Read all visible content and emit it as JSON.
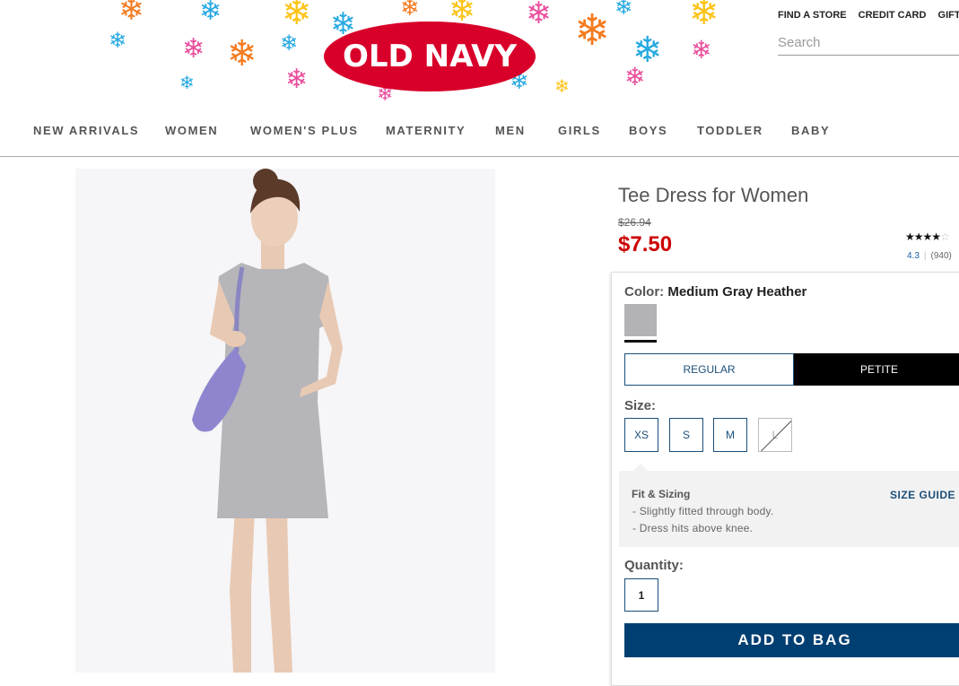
{
  "header": {
    "logo_text": "OLD NAVY",
    "utility_links": [
      "FIND A STORE",
      "CREDIT CARD",
      "GIFT CA"
    ],
    "search_placeholder": "Search"
  },
  "nav": [
    "NEW ARRIVALS",
    "WOMEN",
    "WOMEN'S PLUS",
    "MATERNITY",
    "MEN",
    "GIRLS",
    "BOYS",
    "TODDLER",
    "BABY"
  ],
  "product": {
    "title": "Tee Dress for Women",
    "old_price": "$26.94",
    "sale_price": "$7.50",
    "rating_stars": 4.3,
    "rating_value": "4.3",
    "review_count": "(940)",
    "color_label": "Color:",
    "color_value": "Medium Gray Heather",
    "fit_options": [
      "REGULAR",
      "PETITE"
    ],
    "selected_fit": "PETITE",
    "size_label": "Size:",
    "sizes": [
      "XS",
      "S",
      "M",
      "L"
    ],
    "unavailable_sizes": [
      "L"
    ],
    "fit_sizing_title": "Fit & Sizing",
    "fit_sizing_lines": [
      "- Slightly fitted through body.",
      "- Dress hits above knee."
    ],
    "size_guide": "SIZE GUIDE",
    "quantity_label": "Quantity:",
    "quantity_value": "1",
    "add_to_bag": "ADD TO BAG"
  },
  "colors": {
    "brand_red": "#d8002a",
    "sale_red": "#cc0000",
    "navy": "#003f72",
    "swatch": "#b3b2b6"
  }
}
